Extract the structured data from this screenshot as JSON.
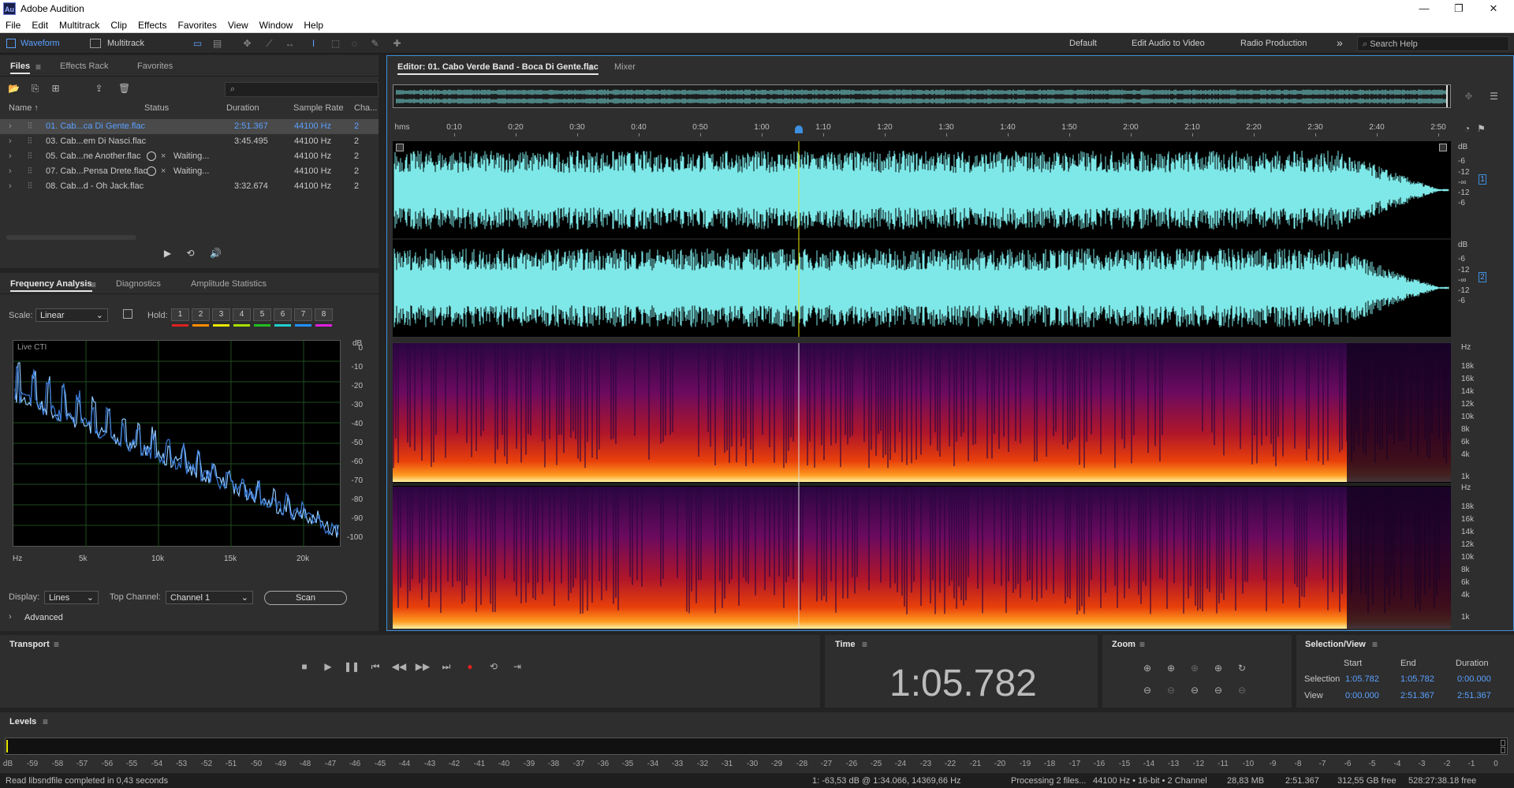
{
  "app": {
    "title": "Adobe Audition",
    "logo": "Au"
  },
  "menu": [
    "File",
    "Edit",
    "Multitrack",
    "Clip",
    "Effects",
    "Favorites",
    "View",
    "Window",
    "Help"
  ],
  "toolbar": {
    "waveform_label": "Waveform",
    "multitrack_label": "Multitrack",
    "workspaces": [
      "Default",
      "Edit Audio to Video",
      "Radio Production"
    ],
    "search_placeholder": "Search Help",
    "more_icon": "»"
  },
  "files_panel": {
    "tabs": [
      "Files",
      "Effects Rack",
      "Favorites"
    ],
    "columns": [
      "Name ↑",
      "Status",
      "Duration",
      "Sample Rate",
      "Cha..."
    ],
    "rows": [
      {
        "name": "01. Cab...ca Di Gente.flac",
        "status": "",
        "duration": "2:51.367",
        "rate": "44100 Hz",
        "ch": "2",
        "selected": true
      },
      {
        "name": "03. Cab...em Di Nasci.flac",
        "status": "",
        "duration": "3:45.495",
        "rate": "44100 Hz",
        "ch": "2",
        "selected": false
      },
      {
        "name": "05. Cab...ne Another.flac",
        "status": "Waiting...",
        "duration": "",
        "rate": "44100 Hz",
        "ch": "2",
        "selected": false
      },
      {
        "name": "07. Cab...Pensa Drete.flac",
        "status": "Waiting...",
        "duration": "",
        "rate": "44100 Hz",
        "ch": "2",
        "selected": false
      },
      {
        "name": "08. Cab...d - Oh Jack.flac",
        "status": "",
        "duration": "3:32.674",
        "rate": "44100 Hz",
        "ch": "2",
        "selected": false
      }
    ]
  },
  "freq_panel": {
    "tabs": [
      "Frequency Analysis",
      "Diagnostics",
      "Amplitude Statistics"
    ],
    "scale_label": "Scale:",
    "scale_value": "Linear",
    "hold_label": "Hold:",
    "hold_buttons": [
      "1",
      "2",
      "3",
      "4",
      "5",
      "6",
      "7",
      "8"
    ],
    "hold_colors": [
      "#e02020",
      "#ff8c00",
      "#e8e800",
      "#a8e000",
      "#20c020",
      "#20d0d0",
      "#2090ff",
      "#e020e0"
    ],
    "graph_label": "Live CTI",
    "db_unit": "dB",
    "db_ticks": [
      "0",
      "-10",
      "-20",
      "-30",
      "-40",
      "-50",
      "-60",
      "-70",
      "-80",
      "-90",
      "-100"
    ],
    "hz_ticks": [
      "Hz",
      "5k",
      "10k",
      "15k",
      "20k"
    ],
    "display_label": "Display:",
    "display_value": "Lines",
    "top_channel_label": "Top Channel:",
    "top_channel_value": "Channel 1",
    "scan_label": "Scan",
    "advanced_label": "Advanced"
  },
  "editor": {
    "tab_label": "Editor: 01. Cabo Verde Band - Boca Di Gente.flac",
    "mixer_label": "Mixer",
    "ruler_unit": "hms",
    "ruler_labels": [
      "0:10",
      "0:20",
      "0:30",
      "0:40",
      "0:50",
      "1:00",
      "1:10",
      "1:20",
      "1:30",
      "1:40",
      "1:50",
      "2:00",
      "2:10",
      "2:20",
      "2:30",
      "2:40",
      "2:50"
    ],
    "db_labels": [
      "dB",
      "-6",
      "-12",
      "-∞",
      "-12",
      "-6"
    ],
    "hz_labels": [
      "Hz",
      "18k",
      "16k",
      "14k",
      "12k",
      "10k",
      "8k",
      "6k",
      "4k",
      "1k"
    ],
    "channel_numbers": [
      "1",
      "2"
    ],
    "playhead_fraction": 0.384,
    "waveform_color": "#7ee8e8"
  },
  "transport": {
    "label": "Transport"
  },
  "time": {
    "label": "Time",
    "value": "1:05.782"
  },
  "zoom": {
    "label": "Zoom"
  },
  "selection": {
    "label": "Selection/View",
    "headers": [
      "Start",
      "End",
      "Duration"
    ],
    "rows": [
      {
        "label": "Selection",
        "start": "1:05.782",
        "end": "1:05.782",
        "duration": "0:00.000"
      },
      {
        "label": "View",
        "start": "0:00.000",
        "end": "2:51.367",
        "duration": "2:51.367"
      }
    ]
  },
  "levels": {
    "label": "Levels",
    "ticks": [
      "dB",
      "-59",
      "-58",
      "-57",
      "-56",
      "-55",
      "-54",
      "-53",
      "-52",
      "-51",
      "-50",
      "-49",
      "-48",
      "-47",
      "-46",
      "-45",
      "-44",
      "-43",
      "-42",
      "-41",
      "-40",
      "-39",
      "-38",
      "-37",
      "-36",
      "-35",
      "-34",
      "-33",
      "-32",
      "-31",
      "-30",
      "-29",
      "-28",
      "-27",
      "-26",
      "-25",
      "-24",
      "-23",
      "-22",
      "-21",
      "-20",
      "-19",
      "-18",
      "-17",
      "-16",
      "-15",
      "-14",
      "-13",
      "-12",
      "-11",
      "-10",
      "-9",
      "-8",
      "-7",
      "-6",
      "-5",
      "-4",
      "-3",
      "-2",
      "-1",
      "0"
    ]
  },
  "status": {
    "left": "Read libsndfile completed in 0,43 seconds",
    "cursor": "1: -63,53 dB @ 1:34.066, 14369,66 Hz",
    "processing": "Processing 2 files...",
    "format": "44100 Hz • 16-bit • 2 Channel",
    "size": "28,83 MB",
    "duration": "2:51.367",
    "free": "312,55 GB free",
    "free_time": "528:27:38.18 free"
  }
}
